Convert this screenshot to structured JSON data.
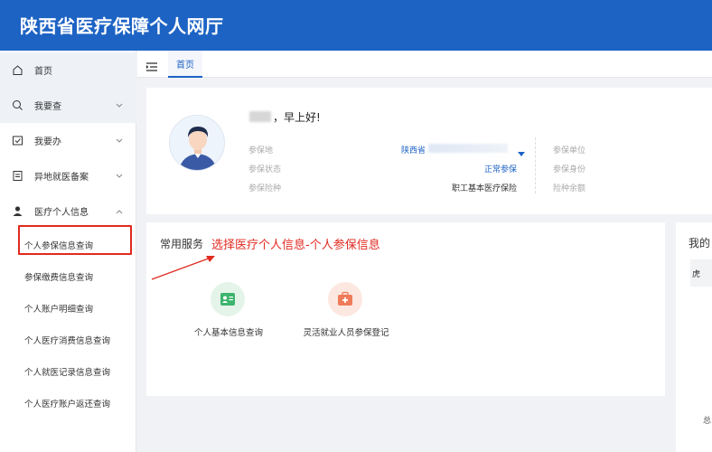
{
  "header": {
    "title": "陕西省医疗保障个人网厅"
  },
  "sidebar": {
    "items": [
      {
        "label": "首页",
        "icon": "home-icon"
      },
      {
        "label": "我要查",
        "icon": "search-icon"
      },
      {
        "label": "我要办",
        "icon": "checkbox-icon"
      },
      {
        "label": "异地就医备案",
        "icon": "document-icon"
      },
      {
        "label": "医疗个人信息",
        "icon": "user-icon"
      }
    ],
    "sub_items": [
      {
        "label": "个人参保信息查询"
      },
      {
        "label": "参保缴费信息查询"
      },
      {
        "label": "个人账户明细查询"
      },
      {
        "label": "个人医疗消费信息查询"
      },
      {
        "label": "个人就医记录信息查询"
      },
      {
        "label": "个人医疗账户返还查询"
      }
    ]
  },
  "tabs": {
    "home": "首页"
  },
  "profile": {
    "greeting": "，早上好!",
    "labels": {
      "region": "参保地",
      "status": "参保状态",
      "insurance_type": "参保险种",
      "unit": "参保单位",
      "identity": "参保身份",
      "type2": "险种余额"
    },
    "values": {
      "region": "陕西省",
      "status": "正常参保",
      "insurance_type": "职工基本医疗保险"
    }
  },
  "services": {
    "title": "常用服务",
    "annotation": "选择医疗个人信息-个人参保信息",
    "items": [
      {
        "label": "个人基本信息查询",
        "icon": "id-card-icon"
      },
      {
        "label": "灵活就业人员参保登记",
        "icon": "medical-kit-icon"
      }
    ]
  },
  "right_panel": {
    "title": "我的",
    "pill": "虎",
    "footer": "总"
  },
  "colors": {
    "brand": "#1d63c4",
    "annotation": "#e02a20",
    "background": "#f0f2f5"
  }
}
